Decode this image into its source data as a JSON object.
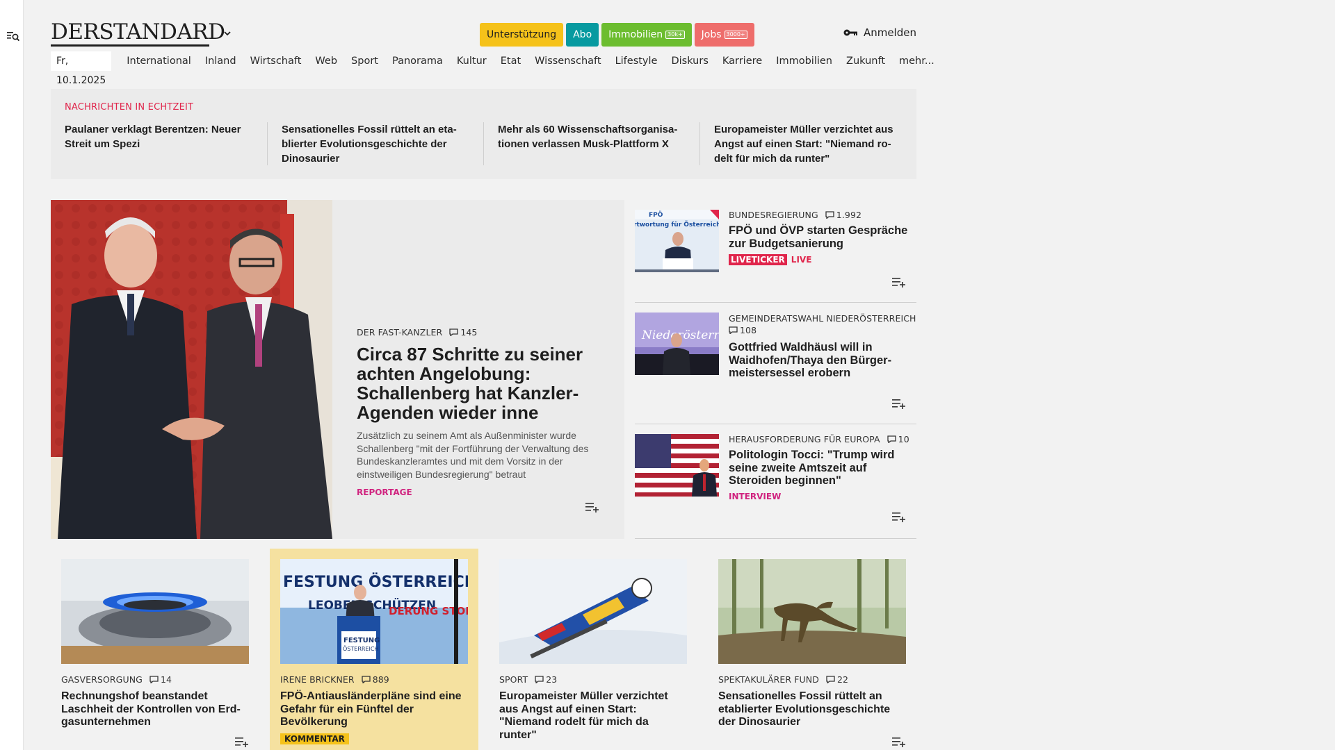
{
  "header": {
    "logo": "DERSTANDARD",
    "buttons": {
      "support": "Unterstützung",
      "abo": "Abo",
      "immobilien": "Immobilien",
      "immobilien_badge": "30k+",
      "jobs": "Jobs",
      "jobs_badge": "3000+"
    },
    "login": "Anmelden"
  },
  "nav": {
    "date": "Fr, 10.1.2025",
    "items": [
      "International",
      "Inland",
      "Wirtschaft",
      "Web",
      "Sport",
      "Panorama",
      "Kultur",
      "Etat",
      "Wissenschaft",
      "Lifestyle",
      "Diskurs",
      "Karriere",
      "Immobilien",
      "Zukunft",
      "mehr..."
    ]
  },
  "ticker": {
    "label": "NACHRICHTEN IN ECHTZEIT",
    "items": [
      "Paulaner verklagt Berentzen: Neuer Streit um Spezi",
      "Sensationelles Fossil rüttelt an eta­blierter Evolutionsgeschichte der Dinosaurier",
      "Mehr als 60 Wissenschaftsorganisa­tionen verlassen Musk-Plattform X",
      "Europameister Müller verzichtet aus Angst auf einen Start: \"Niemand ro­delt für mich da runter\""
    ]
  },
  "lead": {
    "kicker": "DER FAST-KANZLER",
    "comments": "145",
    "title": "Circa 87 Schritte zu seiner achten Angelobung: Schallenberg hat Kanzler-Agenden wieder inne",
    "teaser": "Zusätzlich zu seinem Amt als Außenminister wurde Schallenberg \"mit der Fortführung der Verwaltung des Bundeskanzleramtes und mit dem Vorsitz in der einstweiligen Bundesregierung\" betraut",
    "tag": "REPORTAGE"
  },
  "side": [
    {
      "kicker": "BUNDESREGIERUNG",
      "comments": "1.992",
      "title": "FPÖ und ÖVP starten Gespräche zur Budgetsanierung",
      "liveticker": "LIVETICKER",
      "live": "LIVE"
    },
    {
      "kicker": "GEMEINDERATSWAHL NIEDERÖSTERREICH",
      "comments": "108",
      "title": "Gottfried Waldhäusl will in Waidhofen/Thaya den Bürger­meistersessel erobern"
    },
    {
      "kicker": "HERAUSFORDERUNG FÜR EUROPA",
      "comments": "10",
      "title": "Politologin Tocci: \"Trump wird seine zweite Amtszeit auf Steroiden beginnen\"",
      "tag": "INTERVIEW"
    }
  ],
  "cards": [
    {
      "kicker": "GASVERSORGUNG",
      "comments": "14",
      "title": "Rechnungshof beanstandet Laschheit der Kontrollen von Erd­gasunternehmen"
    },
    {
      "kicker": "IRENE BRICKNER",
      "comments": "889",
      "title": "FPÖ-Antiausländerpläne sind eine Gefahr für ein Fünftel der Bevölkerung",
      "tag": "KOMMENTAR",
      "image_text_1": "FESTUNG ÖSTERREICH",
      "image_text_2": "LEOBEN SCHÜTZEN",
      "image_text_3": "DERUNG STOPPEN",
      "image_text_4": "FESTUNG",
      "image_text_5": "ÖSTERREICH"
    },
    {
      "kicker": "SPORT",
      "comments": "23",
      "title": "Europameister Müller verzichtet aus Angst auf einen Start: \"Niemand rodelt für mich da runter\""
    },
    {
      "kicker": "SPEKTAKULÄRER FUND",
      "comments": "22",
      "title": "Sensationelles Fossil rüttelt an etablierter Evolutionsgeschichte der Dinosaurier"
    }
  ],
  "image_texts": {
    "side_1_banner": "FPÖ",
    "side_1_sub": "rtwortung für Österreich",
    "side_2_banner": "Niederösterreich"
  },
  "colors": {
    "support": "#f5c21a",
    "abo": "#079aa0",
    "immobilien": "#6cbd2f",
    "jobs": "#ee6d6b",
    "live": "#e0254b",
    "reportage": "#d0237f",
    "highlight_card": "#f5e1a0"
  }
}
